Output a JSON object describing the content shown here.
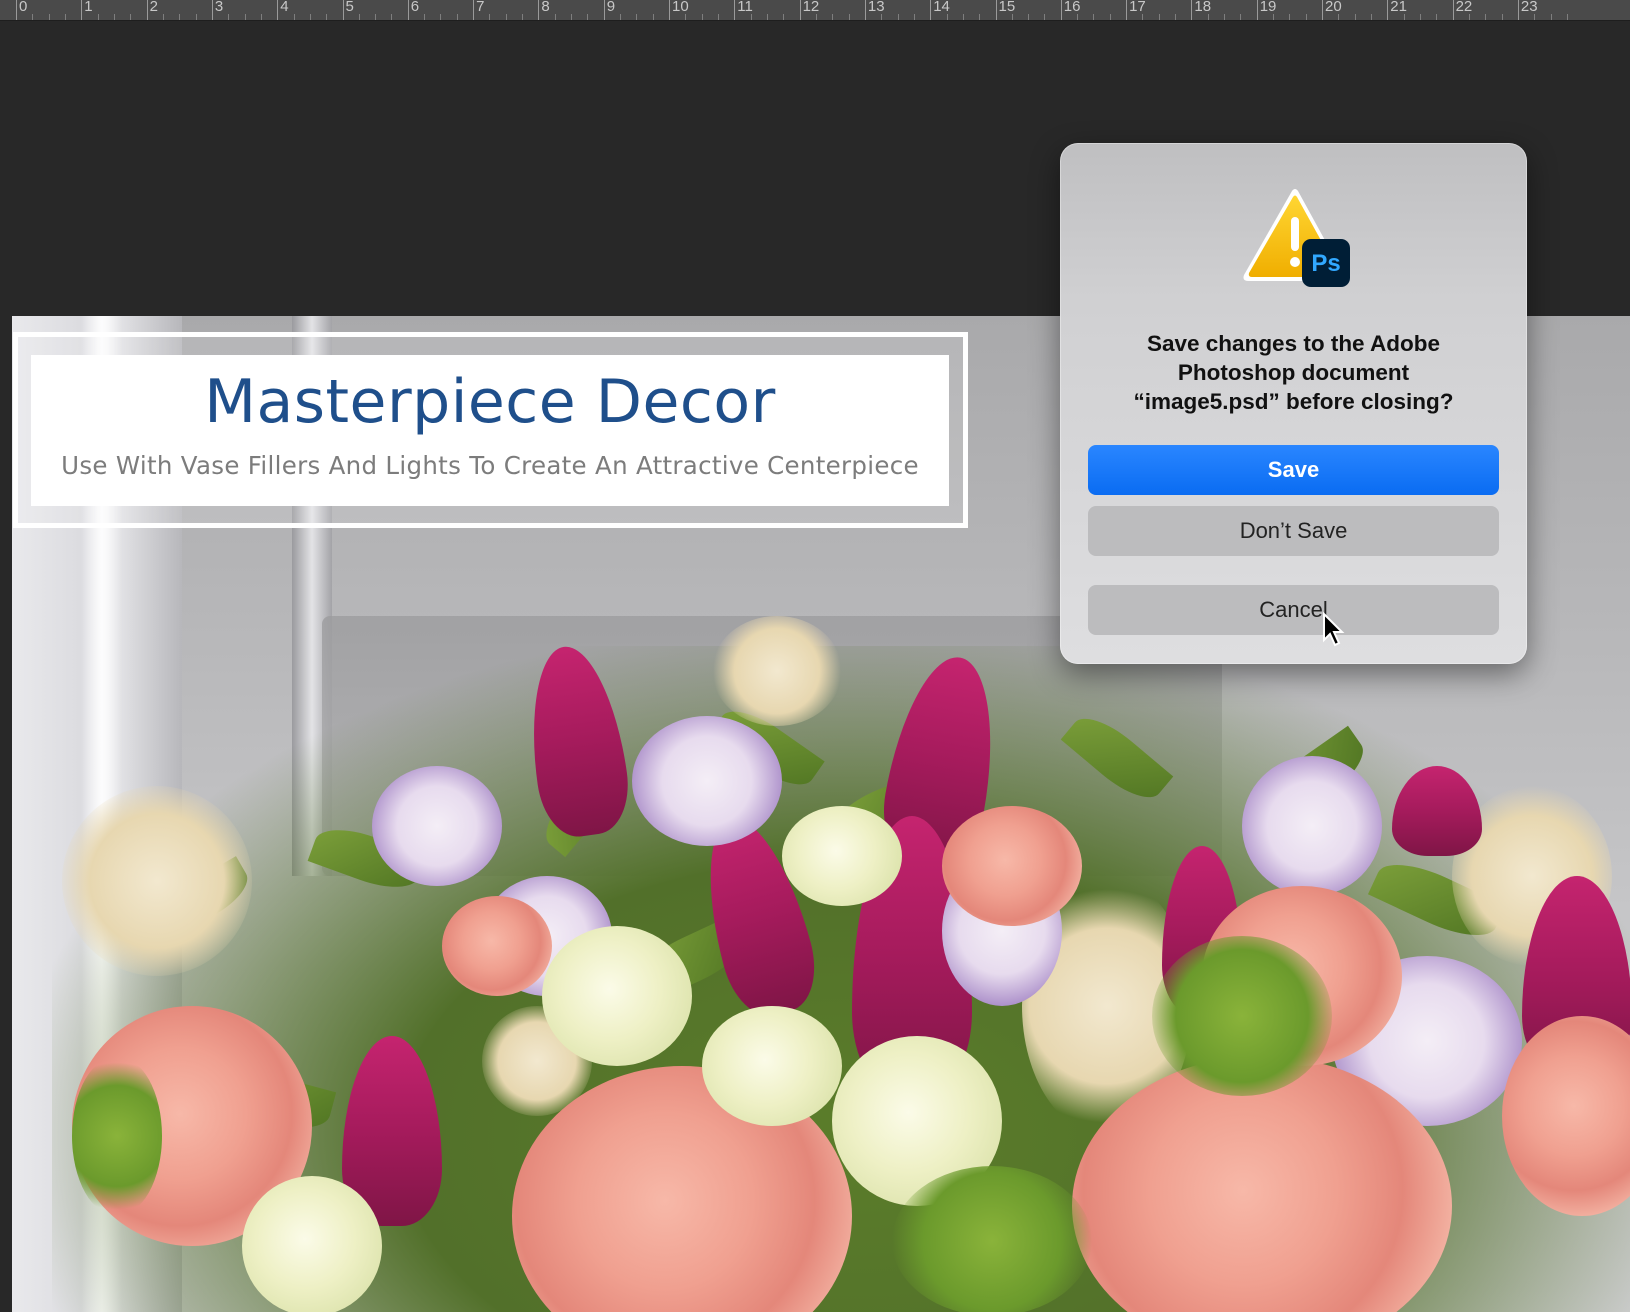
{
  "ruler": {
    "labels": [
      "0",
      "1",
      "2",
      "3",
      "4",
      "5",
      "6",
      "7",
      "8",
      "9",
      "10",
      "11",
      "12",
      "13",
      "14",
      "15",
      "16",
      "17",
      "18",
      "19",
      "20",
      "21",
      "22",
      "23"
    ]
  },
  "document": {
    "banner_title": "Masterpiece Decor",
    "banner_subtitle": "Use With Vase Fillers And Lights To Create An Attractive Centerpiece"
  },
  "dialog": {
    "icon": "warning-triangle-with-photoshop-badge",
    "badge_text": "Ps",
    "message_line1": "Save changes to the Adobe",
    "message_line2": "Photoshop document",
    "message_line3": "“image5.psd” before closing?",
    "save_label": "Save",
    "dont_save_label": "Don’t Save",
    "cancel_label": "Cancel"
  },
  "colors": {
    "accent": "#0a6cf2",
    "banner_title": "#1f4f8b",
    "workspace": "#282828"
  }
}
